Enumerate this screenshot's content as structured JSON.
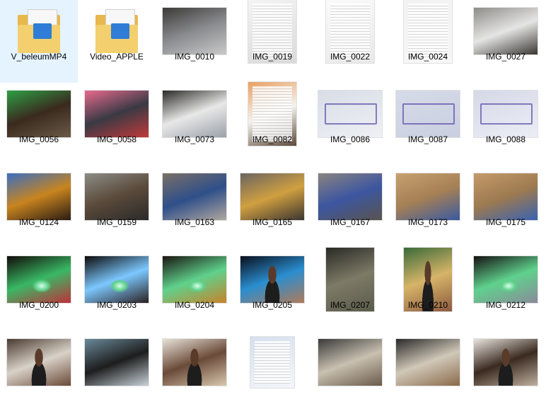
{
  "window": {
    "view": "Large icons"
  },
  "items": [
    {
      "label": "V_beleumMP4",
      "kind": "folder",
      "icon": "video-folder-icon",
      "colors": [
        "#2f7dd6"
      ]
    },
    {
      "label": "Video_APPLE",
      "kind": "folder",
      "icon": "video-folder-icon",
      "colors": [
        "#2f7dd6"
      ]
    },
    {
      "label": "IMG_0010",
      "kind": "photo",
      "colors": [
        "#3c3a38",
        "#8a8b8f",
        "#c9c9c9"
      ]
    },
    {
      "label": "IMG_0019",
      "kind": "doc",
      "colors": [
        "#f4f4f4",
        "#d9d9d9"
      ]
    },
    {
      "label": "IMG_0022",
      "kind": "doc",
      "colors": [
        "#fbfbfb",
        "#e8e8e8"
      ]
    },
    {
      "label": "IMG_0024",
      "kind": "doc",
      "colors": [
        "#f2f2f2",
        "#f7f7f7"
      ]
    },
    {
      "label": "IMG_0027",
      "kind": "photo",
      "colors": [
        "#8e8c88",
        "#e5e5e5",
        "#3a3733"
      ]
    },
    {
      "label": "IMG_0056",
      "kind": "photo",
      "colors": [
        "#2ea046",
        "#3a2a1e",
        "#6b5a46"
      ]
    },
    {
      "label": "IMG_0058",
      "kind": "photo",
      "colors": [
        "#e86a8e",
        "#3a3a44",
        "#c03a3a"
      ]
    },
    {
      "label": "IMG_0073",
      "kind": "photo",
      "colors": [
        "#2b2a28",
        "#e8e8e8",
        "#9aa0a8"
      ]
    },
    {
      "label": "IMG_0082",
      "kind": "doc",
      "colors": [
        "#e8a062",
        "#f4f2ee",
        "#5c4a3a"
      ]
    },
    {
      "label": "IMG_0086",
      "kind": "stamp",
      "colors": [
        "#d8dde6",
        "#eef0f4"
      ]
    },
    {
      "label": "IMG_0087",
      "kind": "stamp",
      "colors": [
        "#d6dbe8",
        "#c9cfe0"
      ]
    },
    {
      "label": "IMG_0088",
      "kind": "stamp",
      "colors": [
        "#d5d8e6",
        "#eceef6"
      ]
    },
    {
      "label": "IMG_0124",
      "kind": "photo",
      "colors": [
        "#3a6fc0",
        "#c8841e",
        "#2a1c14"
      ]
    },
    {
      "label": "IMG_0159",
      "kind": "photo",
      "colors": [
        "#8b8c86",
        "#5a4a3a",
        "#2a2a2a"
      ]
    },
    {
      "label": "IMG_0163",
      "kind": "photo",
      "colors": [
        "#7a6f66",
        "#2f4f8a",
        "#b0a79e"
      ]
    },
    {
      "label": "IMG_0165",
      "kind": "photo",
      "colors": [
        "#6b6461",
        "#d0a040",
        "#3b3431"
      ]
    },
    {
      "label": "IMG_0167",
      "kind": "photo",
      "colors": [
        "#8a8380",
        "#3c56a0",
        "#5a5450"
      ]
    },
    {
      "label": "IMG_0173",
      "kind": "photo",
      "colors": [
        "#c8a070",
        "#a58055",
        "#3a5aa0"
      ]
    },
    {
      "label": "IMG_0175",
      "kind": "photo",
      "colors": [
        "#c49a6a",
        "#9d7a50",
        "#3a62b0"
      ]
    },
    {
      "label": "IMG_0200",
      "kind": "night",
      "colors": [
        "#120a08",
        "#39b864",
        "#c0303a"
      ]
    },
    {
      "label": "IMG_0203",
      "kind": "night",
      "colors": [
        "#0c0a0a",
        "#7cc8ff",
        "#2a2020"
      ]
    },
    {
      "label": "IMG_0204",
      "kind": "night",
      "colors": [
        "#1a1410",
        "#5fd18c",
        "#c8822a"
      ]
    },
    {
      "label": "IMG_0205",
      "kind": "selfie",
      "colors": [
        "#0a0f1c",
        "#2a8ed0",
        "#b07a5a"
      ]
    },
    {
      "label": "IMG_0207",
      "kind": "photo",
      "colors": [
        "#2a2a26",
        "#7d7a66",
        "#5a5a4a"
      ]
    },
    {
      "label": "IMG_0210",
      "kind": "selfie",
      "colors": [
        "#3a6a3a",
        "#d6b468",
        "#8c5a40"
      ]
    },
    {
      "label": "IMG_0212",
      "kind": "night",
      "colors": [
        "#151012",
        "#5fd18c",
        "#8a8a9a"
      ]
    },
    {
      "label": "",
      "kind": "selfie",
      "colors": [
        "#4a3a30",
        "#d9d2c8",
        "#6a4a38"
      ]
    },
    {
      "label": "",
      "kind": "photo",
      "colors": [
        "#6a8a9a",
        "#1d1d1d",
        "#c8d2d8"
      ]
    },
    {
      "label": "",
      "kind": "selfie",
      "colors": [
        "#e8e2d8",
        "#6a4a38",
        "#d9c8b0"
      ]
    },
    {
      "label": "",
      "kind": "doc",
      "colors": [
        "#d6dfee",
        "#f4f6fa"
      ]
    },
    {
      "label": "",
      "kind": "photo",
      "colors": [
        "#3a3a3a",
        "#c8c0b0",
        "#6a5a4a"
      ]
    },
    {
      "label": "",
      "kind": "photo",
      "colors": [
        "#2a2a2a",
        "#d0c8b8",
        "#8a6a4a"
      ]
    },
    {
      "label": "",
      "kind": "selfie",
      "colors": [
        "#e8e4de",
        "#3a2a20",
        "#c0b0a0"
      ]
    }
  ]
}
